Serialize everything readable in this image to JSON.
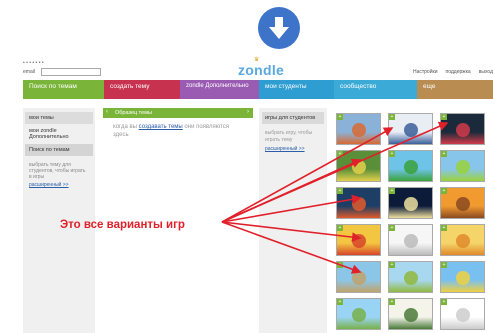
{
  "page": {
    "top_heading": "",
    "annotation": "Это все варианты игр"
  },
  "site": {
    "logo_text": "zondle",
    "email_label": "email",
    "top_links": [
      "Настройки",
      "поддержка",
      "выход"
    ]
  },
  "nav": {
    "tabs": [
      "Поиск по темам",
      "создать тему",
      "zondle Дополнительно",
      "мои студенты",
      "сообщество",
      "еще"
    ]
  },
  "left_panel": {
    "items": [
      "мои темы",
      "мои zondle Дополнительно"
    ],
    "search_button": "Поиск по темам",
    "note": "выбрать тему для студентов, чтобы играть в игры",
    "link": "расширенный >>"
  },
  "middle_panel": {
    "header": "Образец темы",
    "text_before": "когда вы",
    "text_link": "создавать темы",
    "text_after": "они появляются здесь"
  },
  "games_panel": {
    "header": "игры для студентов",
    "note": "выбрать игру, чтобы играть тему",
    "link": "расширенный >>"
  },
  "thumbnails": [
    {
      "name": "game-1",
      "colors": [
        "#8ab2d8",
        "#d86a32"
      ]
    },
    {
      "name": "game-2",
      "colors": [
        "#e9eef5",
        "#3b5f9a"
      ]
    },
    {
      "name": "game-3",
      "colors": [
        "#1a2a3a",
        "#d23a4a"
      ]
    },
    {
      "name": "game-4",
      "colors": [
        "#5a8f3a",
        "#e3d04a"
      ]
    },
    {
      "name": "game-5",
      "colors": [
        "#6ec3e8",
        "#3aa23a"
      ]
    },
    {
      "name": "game-6",
      "colors": [
        "#87c5ea",
        "#9ad23a"
      ]
    },
    {
      "name": "game-7",
      "colors": [
        "#1d3f66",
        "#e05a2a"
      ]
    },
    {
      "name": "game-8",
      "colors": [
        "#0c1b3a",
        "#f0e0a0"
      ]
    },
    {
      "name": "game-9",
      "colors": [
        "#f09a30",
        "#8a4a20"
      ]
    },
    {
      "name": "game-10",
      "colors": [
        "#f2c640",
        "#d8452a"
      ]
    },
    {
      "name": "game-11",
      "colors": [
        "#f6f6f6",
        "#bbbbbb"
      ]
    },
    {
      "name": "game-12",
      "colors": [
        "#f5d56a",
        "#e0892a"
      ]
    },
    {
      "name": "game-13",
      "colors": [
        "#8bc6e8",
        "#c0a26a"
      ]
    },
    {
      "name": "game-14",
      "colors": [
        "#a8d8f0",
        "#90b840"
      ]
    },
    {
      "name": "game-15",
      "colors": [
        "#78c0f0",
        "#f0d040"
      ]
    },
    {
      "name": "game-16",
      "colors": [
        "#9ad4f4",
        "#78b04a"
      ]
    },
    {
      "name": "game-17",
      "colors": [
        "#f4f4ea",
        "#4a7a3a"
      ]
    },
    {
      "name": "game-18",
      "colors": [
        "#ffffff",
        "#cccccc"
      ]
    },
    {
      "name": "game-19",
      "colors": [
        "#9ccc5a",
        "#4a88d0"
      ]
    },
    {
      "name": "game-20",
      "colors": [
        "#e4e4e4",
        "#777777"
      ]
    },
    {
      "name": "game-21",
      "colors": [
        "#6ab8e8",
        "#d8b05a"
      ]
    },
    {
      "name": "game-22",
      "colors": [
        "#6ea8d8",
        "#86c050"
      ]
    },
    {
      "name": "game-23",
      "colors": [
        "#f2f2f2",
        "#d8d8d8"
      ]
    },
    {
      "name": "game-24",
      "colors": [
        "#c8e8f8",
        "#a0c060"
      ]
    }
  ],
  "colors": {
    "nav_green": "#7ab53a",
    "nav_red": "#c7324f",
    "nav_purple": "#9a5cb2",
    "nav_blue": "#2e9dd2",
    "annotation_red": "#e0202a",
    "download_blue": "#3d73c9"
  }
}
